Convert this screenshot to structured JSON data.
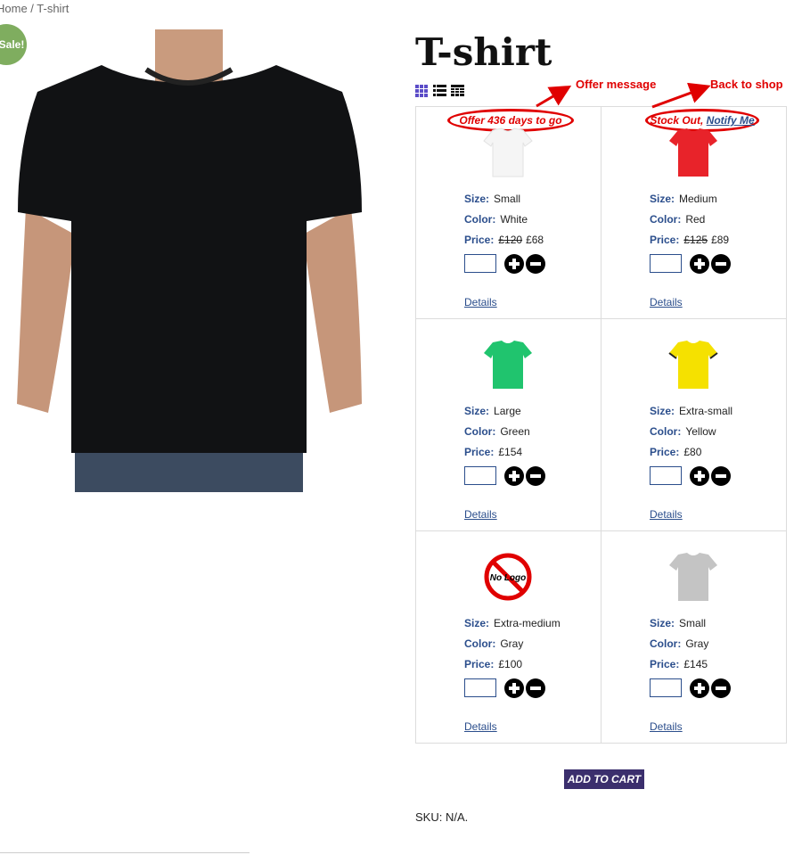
{
  "breadcrumb": "Home / T-shirt",
  "sale_badge": "Sale!",
  "product": {
    "title": "T-shirt",
    "image": "black-tshirt-model"
  },
  "view_modes": [
    "grid-view-icon",
    "list-view-icon",
    "table-view-icon"
  ],
  "variations": [
    {
      "size": "Small",
      "color": "White",
      "price_old": "£120",
      "price": "£68",
      "swatch": "#f7f7f7",
      "message": "Offer 436 days to go"
    },
    {
      "size": "Medium",
      "color": "Red",
      "price_old": "£125",
      "price": "£89",
      "swatch": "#e8232a",
      "message": "Stock Out,",
      "message_link": "Notify Me"
    },
    {
      "size": "Large",
      "color": "Green",
      "price_old": "",
      "price": "£154",
      "swatch": "#20c46e"
    },
    {
      "size": "Extra-small",
      "color": "Yellow",
      "price_old": "",
      "price": "£80",
      "swatch": "#f5e100"
    },
    {
      "size": "Extra-medium",
      "color": "Gray",
      "price_old": "",
      "price": "£100",
      "swatch": "no-logo",
      "no_logo_text": "No Logo"
    },
    {
      "size": "Small",
      "color": "Gray",
      "price_old": "",
      "price": "£145",
      "swatch": "#c4c4c4"
    }
  ],
  "labels": {
    "size": "Size:",
    "color": "Color:",
    "price": "Price:",
    "details": "Details"
  },
  "annotations": {
    "offer": "Offer message",
    "back": "Back to shop"
  },
  "cart": {
    "add_to_cart": "ADD TO CART"
  },
  "sku": "SKU: N/A."
}
